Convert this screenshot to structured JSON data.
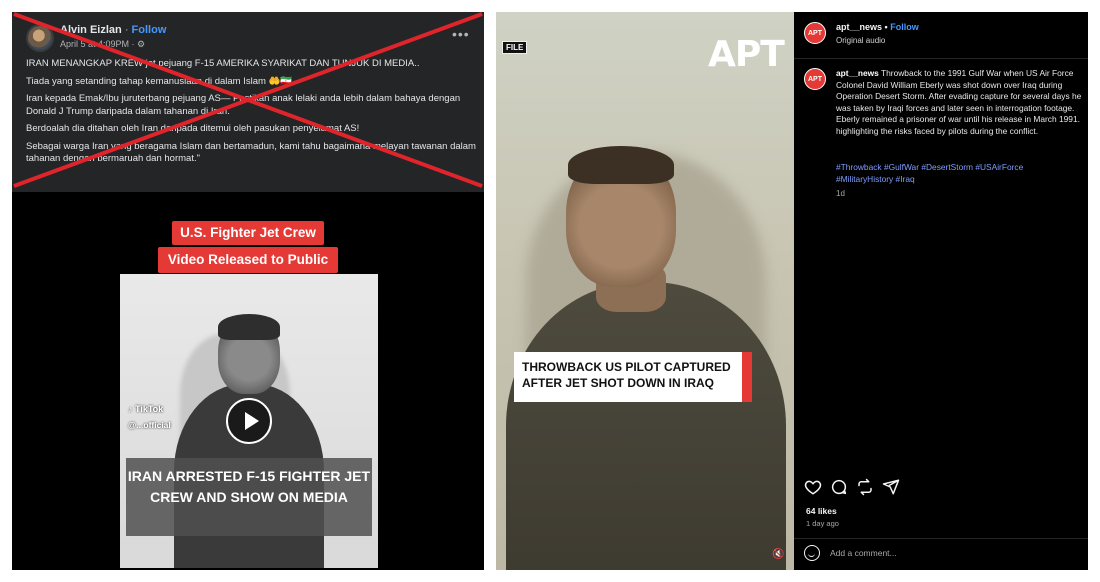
{
  "facebook_post": {
    "author": "Alvin Eizlan",
    "follow_label": "Follow",
    "separator": "·",
    "timestamp": "April 5 at 4:09PM · ⚙",
    "paragraphs": [
      "IRAN MENANGKAP KREW jet pejuang F-15 AMERIKA SYARIKAT DAN TUNJUK DI MEDIA..",
      "Tiada yang setanding tahap kemanusiaan di dalam Islam 🤲🇮🇷",
      "Iran kepada Emak/Ibu juruterbang pejuang AS— Pastikan anak lelaki anda lebih dalam bahaya dengan Donald J Trump daripada dalam tahanan di Iran.",
      "Berdoalah dia ditahan oleh Iran daripada ditemui oleh pasukan penyelamat AS!",
      "Sebagai warga Iran yang beragama Islam dan bertamadun, kami tahu bagaimana melayan tawanan dalam tahanan dengan bermaruah dan hormat.\""
    ],
    "banner_line1": "U.S. Fighter Jet Crew",
    "banner_line2": "Video Released to Public",
    "tiktok_label": "TikTok",
    "tiktok_handle": "@...official",
    "video_caption": "IRAN ARRESTED F-15 FIGHTER JET CREW AND SHOW ON MEDIA"
  },
  "instagram_post": {
    "file_tag": "FILE",
    "brand_logo": "APT",
    "lower_third": "THROWBACK US PILOT CAPTURED AFTER JET SHOT DOWN IN IRAQ",
    "account": "apt__news",
    "follow_label": "Follow",
    "separator": "•",
    "audio": "Original audio",
    "caption_user": "apt__news",
    "caption_text": "Throwback to the 1991 Gulf War when US Air Force Colonel David William Eberly was shot down over Iraq during Operation Desert Storm. After evading capture for several days he was taken by Iraqi forces and later seen in interrogation footage. Eberly remained a prisoner of war until his release in March 1991. highlighting the risks faced by pilots during the conflict.",
    "hashtags": "#Throwback #GulfWar #DesertStorm #USAirForce #MilitaryHistory #Iraq",
    "caption_age": "1d",
    "likes": "64 likes",
    "posted": "1 day ago",
    "comment_placeholder": "Add a comment...",
    "icons": [
      "heart-icon",
      "comment-icon",
      "repost-icon",
      "share-icon",
      "mute-icon",
      "emoji-icon"
    ]
  },
  "colors": {
    "fb_background": "#242526",
    "cross_red": "#e0242b",
    "banner_red": "#e53935",
    "link_blue": "#4599ff",
    "hashtag_blue": "#7e9cff"
  }
}
